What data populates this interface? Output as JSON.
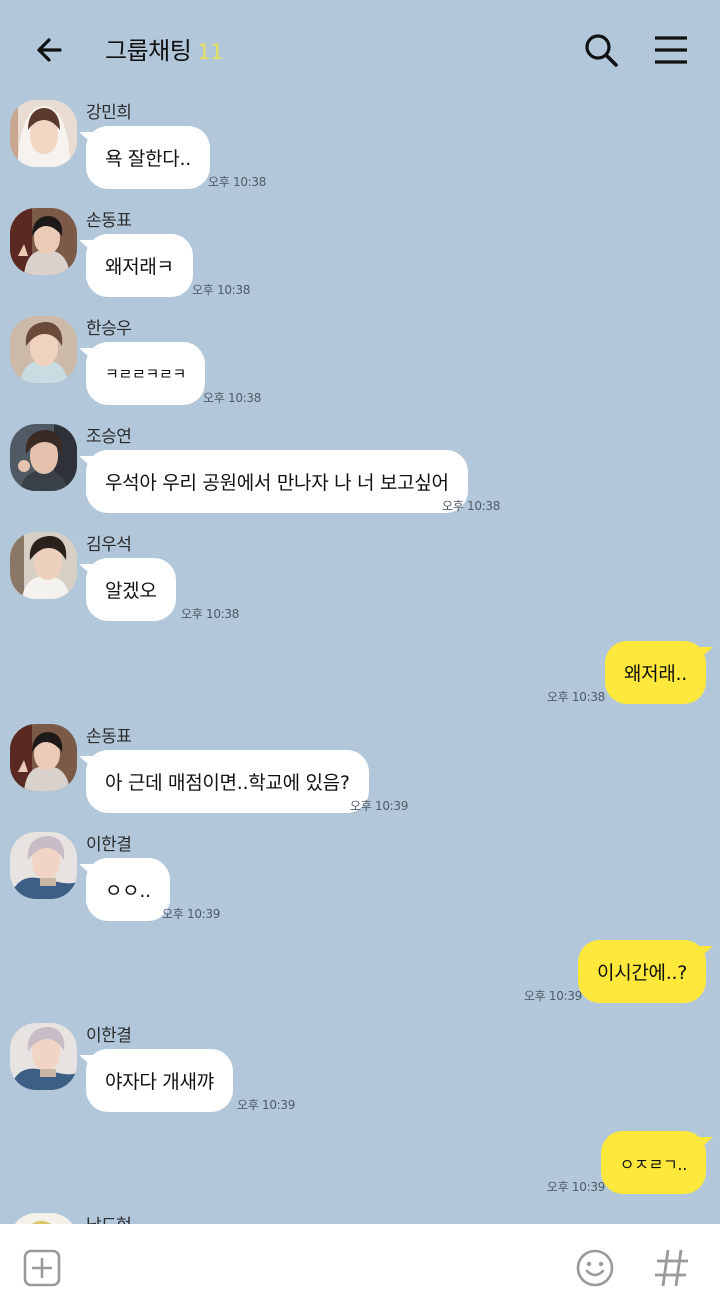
{
  "header": {
    "title": "그룹채팅",
    "member_count": "11",
    "back_icon": "arrow-left-icon",
    "search_icon": "search-icon",
    "menu_icon": "hamburger-menu-icon"
  },
  "messages": [
    {
      "sender": "강민희",
      "text": "욕 잘한다..",
      "time": "오후 10:38"
    },
    {
      "sender": "손동표",
      "text": "왜저래ㅋ",
      "time": "오후 10:38"
    },
    {
      "sender": "한승우",
      "text": "ㅋㄹㄹㅋㄹㅋ",
      "time": "오후 10:38"
    },
    {
      "sender": "조승연",
      "text": "우석아 우리 공원에서 만나자 나 너 보고싶어",
      "time": "오후 10:38"
    },
    {
      "sender": "김우석",
      "text": "알겠오",
      "time": "오후 10:38"
    },
    {
      "mine": true,
      "text": "왜저래..",
      "time": "오후 10:38"
    },
    {
      "sender": "손동표",
      "text": "아 근데 매점이면..학교에 있음?",
      "time": "오후 10:39"
    },
    {
      "sender": "이한결",
      "text": "ㅇㅇ..",
      "time": "오후 10:39"
    },
    {
      "mine": true,
      "text": "이시간에..?",
      "time": "오후 10:39"
    },
    {
      "sender": "이한결",
      "text": "야자다 개새꺄",
      "time": "오후 10:39"
    },
    {
      "mine": true,
      "text": "ㅇㅈㄹㄱ..",
      "time": "오후 10:39"
    },
    {
      "sender": "남도현",
      "text": "",
      "time": ""
    }
  ],
  "input_bar": {
    "plus_icon": "plus-square-icon",
    "emoji_icon": "smiley-icon",
    "hash_icon": "hashtag-icon"
  },
  "colors": {
    "background": "#b2c7da",
    "my_bubble": "#fee83b",
    "their_bubble": "#ffffff",
    "member_count": "#e8e25a"
  }
}
